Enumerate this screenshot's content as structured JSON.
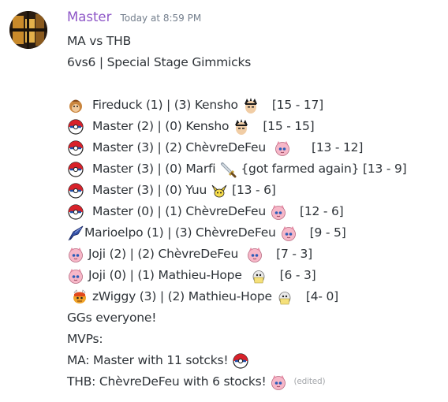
{
  "message": {
    "author": "Master",
    "timestamp": "Today at 8:59 PM",
    "lines": {
      "title": "MA vs THB",
      "subtitle": "6vs6 | Special Stage Gimmicks",
      "r1_text": "Fireduck (1) | (3) Kensho",
      "r1_score": "[15 - 17]",
      "r2_text": "Master (2) | (0) Kensho",
      "r2_score": "[15 - 15]",
      "r3_text": "Master (3) | (2) ChèvreDeFeu",
      "r3_score": "[13 - 12]",
      "r4_text": "Master (3) | (0) Marfi",
      "r4_note": "{got farmed again} [13 - 9]",
      "r5_text": "Master (3) | (0) Yuu",
      "r5_score": "[13 - 6]",
      "r6_text": "Master (0) | (1) ChèvreDeFeu",
      "r6_score": "[12 - 6]",
      "r7_text": "Marioelpo (1) | (3) ChèvreDeFeu",
      "r7_score": "[9 - 5]",
      "r8_text": "Joji (2) | (2) ChèvreDeFeu",
      "r8_score": "[7 - 3]",
      "r9_text": "Joji (0) | (1) Mathieu-Hope",
      "r9_score": "[6 - 3]",
      "r10_text": "zWiggy (3) | (2) Mathieu-Hope",
      "r10_score": "[4- 0]",
      "ggs": "GGs everyone!",
      "mvps": "MVPs:",
      "ma_mvp": "MA: Master with 11 sotcks!",
      "thb_mvp": "THB: ChèvreDeFeu with 6 stocks!"
    },
    "edited": "(edited)"
  },
  "icons": {
    "fireduck": "donkey-kong-icon",
    "kensho": "kazuya-icon",
    "master": "mario-ball-icon",
    "chevre": "jigglypuff-icon",
    "marfi": "sword-icon",
    "yuu": "pichu-icon",
    "marioelpo": "falcon-icon",
    "mathieu": "mr-game-and-watch-icon",
    "zwiggy": "bowser-icon"
  }
}
